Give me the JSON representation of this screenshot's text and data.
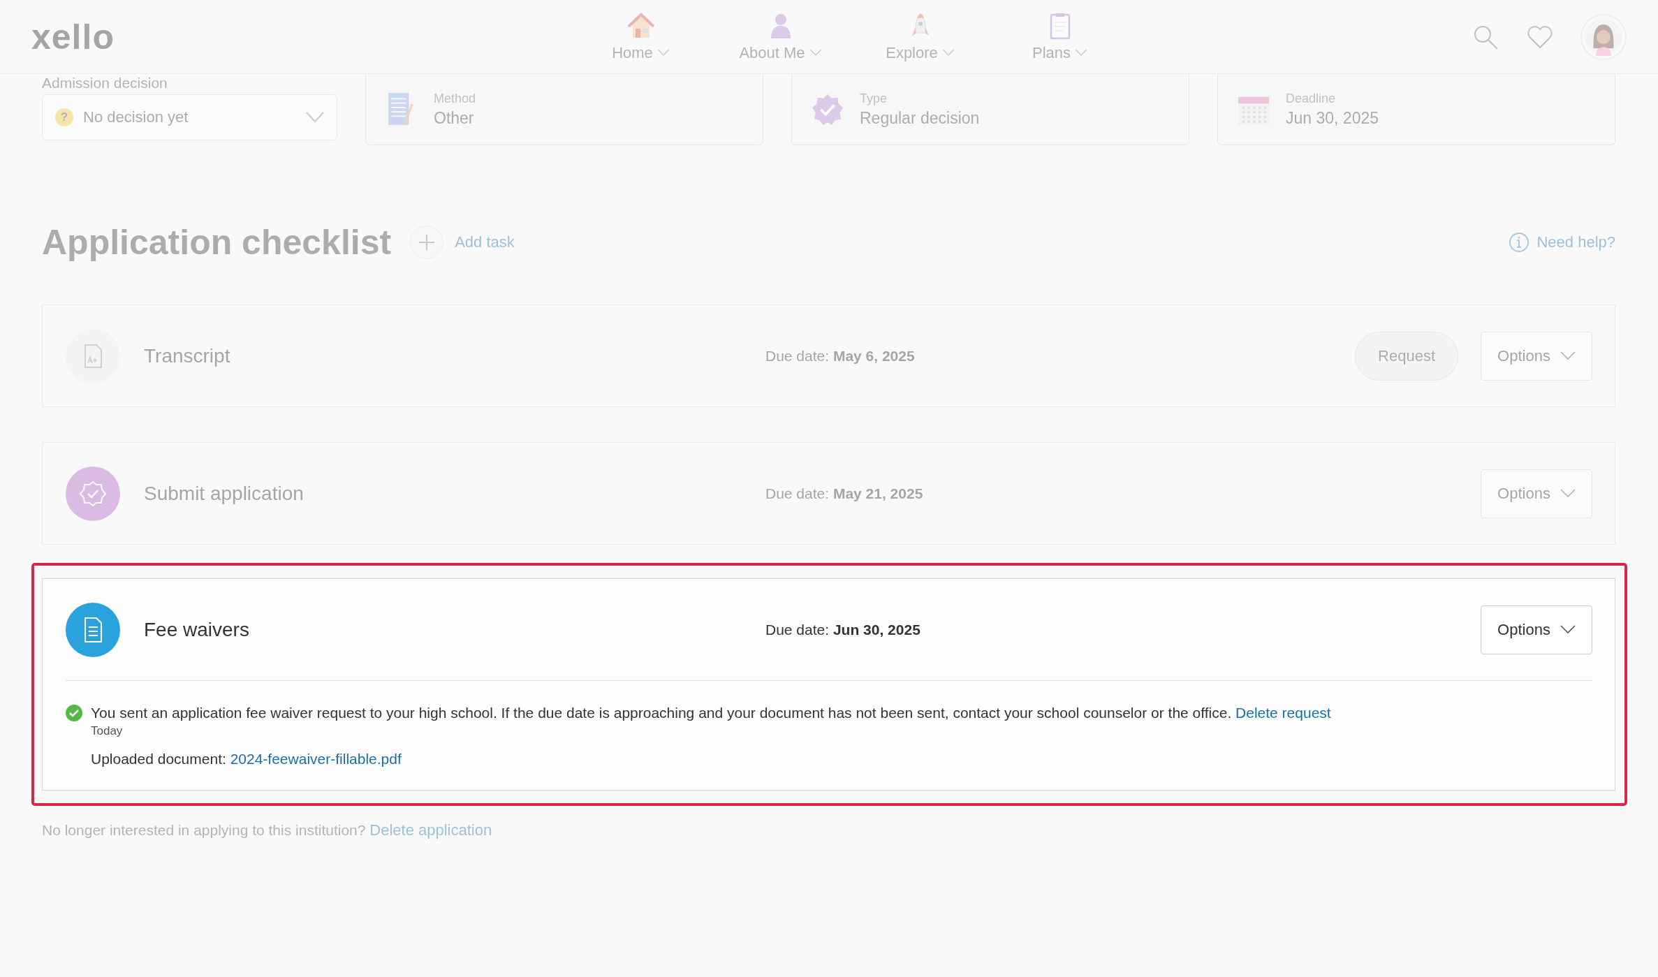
{
  "header": {
    "logo": "xello",
    "nav": [
      {
        "label": "Home",
        "kind": "house"
      },
      {
        "label": "About Me",
        "kind": "person"
      },
      {
        "label": "Explore",
        "kind": "rocket"
      },
      {
        "label": "Plans",
        "kind": "clipboard"
      }
    ]
  },
  "admission": {
    "label": "Admission decision",
    "value": "No decision yet",
    "badge": "?"
  },
  "info_cards": [
    {
      "kind": "method",
      "label": "Method",
      "value": "Other"
    },
    {
      "kind": "type",
      "label": "Type",
      "value": "Regular decision"
    },
    {
      "kind": "deadline",
      "label": "Deadline",
      "value": "Jun 30, 2025"
    }
  ],
  "checklist": {
    "title": "Application checklist",
    "add_task": "Add task",
    "help": "Need help?"
  },
  "tasks": [
    {
      "kind": "transcript",
      "name": "Transcript",
      "due_label": "Due date:",
      "due": "May 6, 2025",
      "request": "Request",
      "options": "Options",
      "highlighted": false
    },
    {
      "kind": "submit",
      "name": "Submit application",
      "due_label": "Due date:",
      "due": "May 21, 2025",
      "options": "Options",
      "highlighted": false
    },
    {
      "kind": "document",
      "name": "Fee waivers",
      "due_label": "Due date:",
      "due": "Jun 30, 2025",
      "options": "Options",
      "highlighted": true,
      "message": "You sent an application fee waiver request to your high school. If the due date is approaching and your document has not been sent, contact your school counselor or the office.",
      "message_link": "Delete request",
      "time": "Today",
      "upload_label": "Uploaded document:",
      "upload_file": "2024-feewaiver-fillable.pdf"
    }
  ],
  "footer": {
    "text": "No longer interested in applying to this institution?",
    "link": "Delete application"
  }
}
